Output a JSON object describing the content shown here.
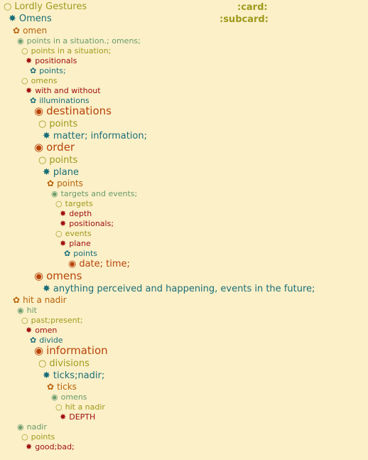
{
  "colors": {
    "background": "#fbf0c8",
    "olive": "#9e9a1c",
    "teal": "#1a6e78",
    "orange": "#b8620a",
    "sage": "#6a9a6a",
    "darkred": "#a01010",
    "rust": "#b8440a"
  },
  "header": {
    "card_tag": ":card:",
    "subcard_tag": ":subcard:"
  },
  "outline": [
    {
      "glyph": "○",
      "text": "Lordly Gestures"
    },
    {
      "glyph": "✸",
      "text": "Omens"
    },
    {
      "glyph": "✿",
      "text": "omen"
    },
    {
      "glyph": "◉",
      "text": "points in a situation.; omens;"
    },
    {
      "glyph": "○",
      "text": "points in a situation;"
    },
    {
      "glyph": "✸",
      "text": "positionals"
    },
    {
      "glyph": "✿",
      "text": "points;"
    },
    {
      "glyph": "○",
      "text": "omens"
    },
    {
      "glyph": "✸",
      "text": "with and without"
    },
    {
      "glyph": "✿",
      "text": "illuminations"
    },
    {
      "glyph": "◉",
      "text": "destinations"
    },
    {
      "glyph": "○",
      "text": "points"
    },
    {
      "glyph": "✸",
      "text": "matter; information;"
    },
    {
      "glyph": "◉",
      "text": "order"
    },
    {
      "glyph": "○",
      "text": "points"
    },
    {
      "glyph": "✸",
      "text": "plane"
    },
    {
      "glyph": "✿",
      "text": "points"
    },
    {
      "glyph": "◉",
      "text": "targets and events;"
    },
    {
      "glyph": "○",
      "text": "targets"
    },
    {
      "glyph": "✸",
      "text": "depth"
    },
    {
      "glyph": "✸",
      "text": "positionals;"
    },
    {
      "glyph": "○",
      "text": "events"
    },
    {
      "glyph": "✸",
      "text": "plane"
    },
    {
      "glyph": "✿",
      "text": "points"
    },
    {
      "glyph": "◉",
      "text": "date; time;"
    },
    {
      "glyph": "◉",
      "text": "omens"
    },
    {
      "glyph": "✸",
      "text": "anything perceived and happening, events in the future;"
    },
    {
      "glyph": "✿",
      "text": "hit a nadir"
    },
    {
      "glyph": "◉",
      "text": "hit"
    },
    {
      "glyph": "○",
      "text": "past;present;"
    },
    {
      "glyph": "✸",
      "text": "omen"
    },
    {
      "glyph": "✿",
      "text": "divide"
    },
    {
      "glyph": "◉",
      "text": "information"
    },
    {
      "glyph": "○",
      "text": "divisions"
    },
    {
      "glyph": "✸",
      "text": "ticks;nadir;"
    },
    {
      "glyph": "✿",
      "text": "ticks"
    },
    {
      "glyph": "◉",
      "text": "omens"
    },
    {
      "glyph": "○",
      "text": "hit a nadir"
    },
    {
      "glyph": "✸",
      "text": "DEPTH"
    },
    {
      "glyph": "◉",
      "text": "nadir"
    },
    {
      "glyph": "○",
      "text": "points"
    },
    {
      "glyph": "✸",
      "text": "good;bad;"
    }
  ]
}
